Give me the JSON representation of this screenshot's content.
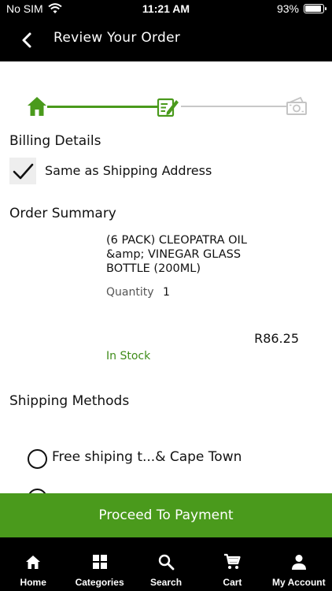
{
  "status_bar": {
    "carrier": "No SIM",
    "time": "11:21 AM",
    "battery": "93%",
    "battery_level": 0.93
  },
  "header": {
    "title": "Review Your Order",
    "back_icon": "chevron-left-icon"
  },
  "stepper": {
    "steps": [
      {
        "icon": "home-icon",
        "state": "completed"
      },
      {
        "icon": "edit-document-icon",
        "state": "active"
      },
      {
        "icon": "payment-icon",
        "state": "pending"
      }
    ],
    "colors": {
      "active": "#4a9a1c",
      "inactive": "#c8c8c8"
    }
  },
  "billing": {
    "title": "Billing Details",
    "same_as_shipping_label": "Same as Shipping Address",
    "same_as_shipping_checked": true
  },
  "order_summary": {
    "title": "Order Summary",
    "items": [
      {
        "name": "(6 PACK) CLEOPATRA  OIL &amp; VINEGAR GLASS BOTTLE (200ML)",
        "quantity_label": "Quantity",
        "quantity": "1",
        "price": "R86.25",
        "stock": "In Stock"
      }
    ]
  },
  "shipping": {
    "title": "Shipping Methods",
    "options": [
      {
        "label": "Free shiping t...& Cape Town",
        "selected": false
      }
    ]
  },
  "proceed_button": {
    "label": "Proceed To Payment",
    "color": "#4a9a1c"
  },
  "tabbar": {
    "tabs": [
      {
        "label": "Home",
        "icon": "home-icon"
      },
      {
        "label": "Categories",
        "icon": "grid-icon"
      },
      {
        "label": "Search",
        "icon": "search-icon"
      },
      {
        "label": "Cart",
        "icon": "cart-icon"
      },
      {
        "label": "My Account",
        "icon": "account-icon"
      }
    ]
  }
}
